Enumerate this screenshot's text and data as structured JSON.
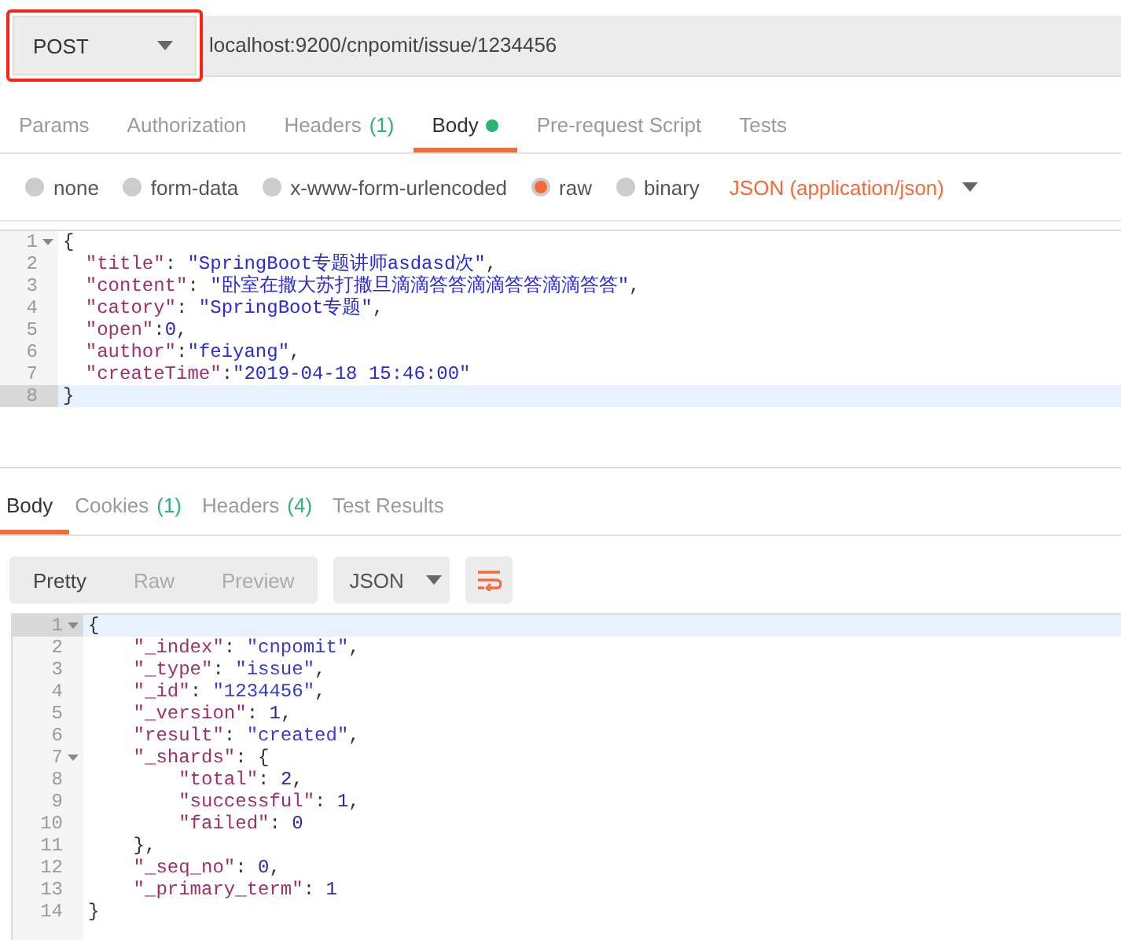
{
  "request": {
    "method": "POST",
    "method_highlighted": true,
    "url": "localhost:9200/cnpomit/issue/1234456"
  },
  "request_tabs": [
    {
      "label": "Params",
      "selected": false,
      "has_content": false
    },
    {
      "label": "Authorization",
      "selected": false,
      "has_content": false
    },
    {
      "label": "Headers",
      "count": "(1)",
      "selected": false,
      "has_content": false
    },
    {
      "label": "Body",
      "selected": true,
      "has_content": true
    },
    {
      "label": "Pre-request Script",
      "selected": false,
      "has_content": false
    },
    {
      "label": "Tests",
      "selected": false,
      "has_content": false
    }
  ],
  "body_types": [
    {
      "label": "none",
      "selected": false
    },
    {
      "label": "form-data",
      "selected": false
    },
    {
      "label": "x-www-form-urlencoded",
      "selected": false
    },
    {
      "label": "raw",
      "selected": true
    },
    {
      "label": "binary",
      "selected": false
    }
  ],
  "raw_format": "JSON (application/json)",
  "request_body": [
    {
      "number": "1",
      "foldable": true,
      "active": false,
      "tokens": [
        {
          "kind": "punct",
          "text": "{"
        }
      ]
    },
    {
      "number": "2",
      "foldable": false,
      "active": false,
      "tokens": [
        {
          "kind": "key",
          "text": "  \"title\""
        },
        {
          "kind": "punct",
          "text": ": "
        },
        {
          "kind": "string",
          "text": "\"SpringBoot专题讲师asdasd次\""
        },
        {
          "kind": "punct",
          "text": ","
        }
      ]
    },
    {
      "number": "3",
      "foldable": false,
      "active": false,
      "tokens": [
        {
          "kind": "key",
          "text": "  \"content\""
        },
        {
          "kind": "punct",
          "text": ": "
        },
        {
          "kind": "string",
          "text": "\"卧室在撒大苏打撒旦滴滴答答滴滴答答滴滴答答\""
        },
        {
          "kind": "punct",
          "text": ","
        }
      ]
    },
    {
      "number": "4",
      "foldable": false,
      "active": false,
      "tokens": [
        {
          "kind": "key",
          "text": "  \"catory\""
        },
        {
          "kind": "punct",
          "text": ": "
        },
        {
          "kind": "string",
          "text": "\"SpringBoot专题\""
        },
        {
          "kind": "punct",
          "text": ","
        }
      ]
    },
    {
      "number": "5",
      "foldable": false,
      "active": false,
      "tokens": [
        {
          "kind": "key",
          "text": "  \"open\""
        },
        {
          "kind": "punct",
          "text": ":"
        },
        {
          "kind": "number",
          "text": "0"
        },
        {
          "kind": "punct",
          "text": ","
        }
      ]
    },
    {
      "number": "6",
      "foldable": false,
      "active": false,
      "tokens": [
        {
          "kind": "key",
          "text": "  \"author\""
        },
        {
          "kind": "punct",
          "text": ":"
        },
        {
          "kind": "string",
          "text": "\"feiyang\""
        },
        {
          "kind": "punct",
          "text": ","
        }
      ]
    },
    {
      "number": "7",
      "foldable": false,
      "active": false,
      "tokens": [
        {
          "kind": "key",
          "text": "  \"createTime\""
        },
        {
          "kind": "punct",
          "text": ":"
        },
        {
          "kind": "string",
          "text": "\"2019-04-18 15:46:00\""
        }
      ]
    },
    {
      "number": "8",
      "foldable": false,
      "active": true,
      "tokens": [
        {
          "kind": "punct",
          "text": "}"
        }
      ]
    }
  ],
  "response_tabs": [
    {
      "label": "Body",
      "selected": true
    },
    {
      "label": "Cookies",
      "count": "(1)",
      "selected": false
    },
    {
      "label": "Headers",
      "count": "(4)",
      "selected": false
    },
    {
      "label": "Test Results",
      "selected": false
    }
  ],
  "view_modes": [
    {
      "label": "Pretty",
      "selected": true
    },
    {
      "label": "Raw",
      "selected": false
    },
    {
      "label": "Preview",
      "selected": false
    }
  ],
  "response_format": "JSON",
  "wrap_lines": true,
  "response_body": [
    {
      "number": "1",
      "foldable": true,
      "active": true,
      "tokens": [
        {
          "kind": "punct",
          "text": "{"
        }
      ]
    },
    {
      "number": "2",
      "foldable": false,
      "active": false,
      "tokens": [
        {
          "kind": "key",
          "text": "    \"_index\""
        },
        {
          "kind": "punct",
          "text": ": "
        },
        {
          "kind": "string",
          "text": "\"cnpomit\""
        },
        {
          "kind": "punct",
          "text": ","
        }
      ]
    },
    {
      "number": "3",
      "foldable": false,
      "active": false,
      "tokens": [
        {
          "kind": "key",
          "text": "    \"_type\""
        },
        {
          "kind": "punct",
          "text": ": "
        },
        {
          "kind": "string",
          "text": "\"issue\""
        },
        {
          "kind": "punct",
          "text": ","
        }
      ]
    },
    {
      "number": "4",
      "foldable": false,
      "active": false,
      "tokens": [
        {
          "kind": "key",
          "text": "    \"_id\""
        },
        {
          "kind": "punct",
          "text": ": "
        },
        {
          "kind": "string",
          "text": "\"1234456\""
        },
        {
          "kind": "punct",
          "text": ","
        }
      ]
    },
    {
      "number": "5",
      "foldable": false,
      "active": false,
      "tokens": [
        {
          "kind": "key",
          "text": "    \"_version\""
        },
        {
          "kind": "punct",
          "text": ": "
        },
        {
          "kind": "number",
          "text": "1"
        },
        {
          "kind": "punct",
          "text": ","
        }
      ]
    },
    {
      "number": "6",
      "foldable": false,
      "active": false,
      "tokens": [
        {
          "kind": "key",
          "text": "    \"result\""
        },
        {
          "kind": "punct",
          "text": ": "
        },
        {
          "kind": "string",
          "text": "\"created\""
        },
        {
          "kind": "punct",
          "text": ","
        }
      ]
    },
    {
      "number": "7",
      "foldable": true,
      "active": false,
      "tokens": [
        {
          "kind": "key",
          "text": "    \"_shards\""
        },
        {
          "kind": "punct",
          "text": ": {"
        }
      ]
    },
    {
      "number": "8",
      "foldable": false,
      "active": false,
      "tokens": [
        {
          "kind": "key",
          "text": "        \"total\""
        },
        {
          "kind": "punct",
          "text": ": "
        },
        {
          "kind": "number",
          "text": "2"
        },
        {
          "kind": "punct",
          "text": ","
        }
      ]
    },
    {
      "number": "9",
      "foldable": false,
      "active": false,
      "tokens": [
        {
          "kind": "key",
          "text": "        \"successful\""
        },
        {
          "kind": "punct",
          "text": ": "
        },
        {
          "kind": "number",
          "text": "1"
        },
        {
          "kind": "punct",
          "text": ","
        }
      ]
    },
    {
      "number": "10",
      "foldable": false,
      "active": false,
      "tokens": [
        {
          "kind": "key",
          "text": "        \"failed\""
        },
        {
          "kind": "punct",
          "text": ": "
        },
        {
          "kind": "number",
          "text": "0"
        }
      ]
    },
    {
      "number": "11",
      "foldable": false,
      "active": false,
      "tokens": [
        {
          "kind": "punct",
          "text": "    },"
        }
      ]
    },
    {
      "number": "12",
      "foldable": false,
      "active": false,
      "tokens": [
        {
          "kind": "key",
          "text": "    \"_seq_no\""
        },
        {
          "kind": "punct",
          "text": ": "
        },
        {
          "kind": "number",
          "text": "0"
        },
        {
          "kind": "punct",
          "text": ","
        }
      ]
    },
    {
      "number": "13",
      "foldable": false,
      "active": false,
      "tokens": [
        {
          "kind": "key",
          "text": "    \"_primary_term\""
        },
        {
          "kind": "punct",
          "text": ": "
        },
        {
          "kind": "number",
          "text": "1"
        }
      ]
    },
    {
      "number": "14",
      "foldable": false,
      "active": false,
      "tokens": [
        {
          "kind": "punct",
          "text": "}"
        }
      ]
    }
  ]
}
